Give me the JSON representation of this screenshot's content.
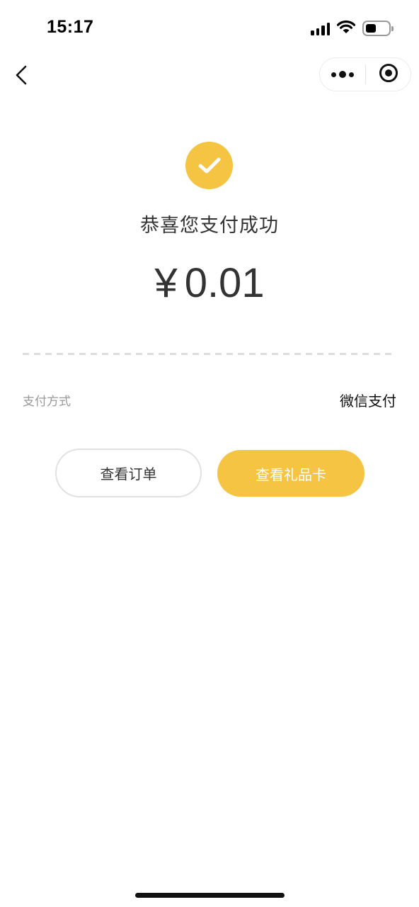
{
  "status_bar": {
    "time": "15:17",
    "icons": [
      "signal-icon",
      "wifi-icon",
      "battery-icon"
    ]
  },
  "nav": {
    "back_icon": "chevron-left-icon",
    "more_icon": "more-dots-icon",
    "close_icon": "target-close-icon"
  },
  "result": {
    "icon": "check-circle-icon",
    "title": "恭喜您支付成功",
    "currency": "¥",
    "amount": "0.01"
  },
  "payment": {
    "label": "支付方式",
    "method": "微信支付"
  },
  "actions": {
    "view_order": "查看订单",
    "view_gift_card": "查看礼品卡"
  },
  "colors": {
    "accent": "#f5c443",
    "text_primary": "#333333",
    "text_secondary": "#999999"
  }
}
